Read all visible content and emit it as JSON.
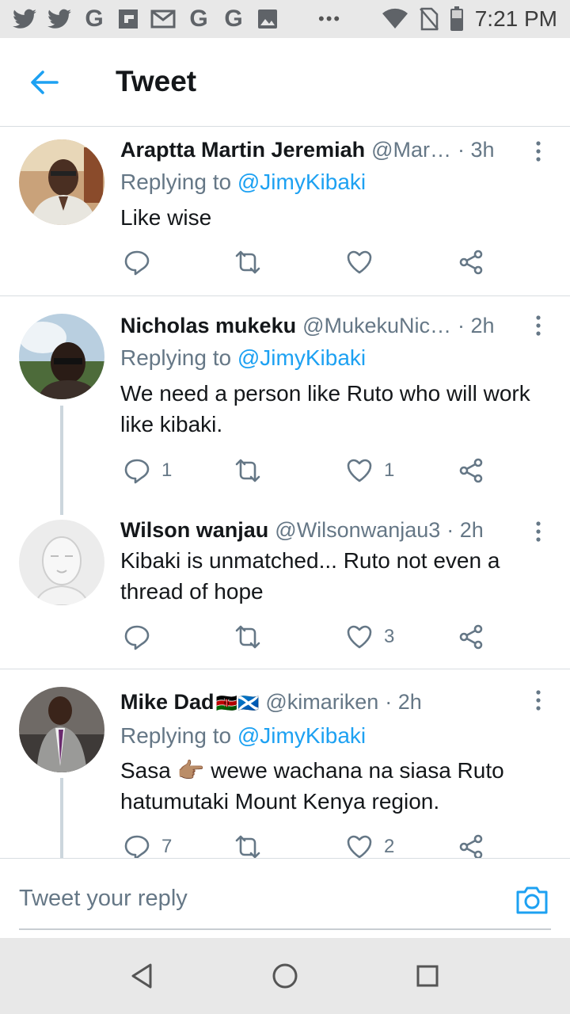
{
  "status_bar": {
    "time": "7:21 PM",
    "notification_icons": [
      "twitter-icon",
      "twitter-icon",
      "google-icon",
      "flipboard-icon",
      "gmail-icon",
      "google-icon",
      "google-icon",
      "image-icon"
    ],
    "overflow": "•••"
  },
  "header": {
    "title": "Tweet"
  },
  "tweets": [
    {
      "name": "Araptta Martin Jeremiah",
      "handle": "@Mar…",
      "time": "· 3h",
      "replying_prefix": "Replying to",
      "replying_to": "@JimyKibaki",
      "text": "Like wise",
      "reply_count": "",
      "like_count": ""
    },
    {
      "name": "Nicholas mukeku",
      "handle": "@MukekuNic…",
      "time": "· 2h",
      "replying_prefix": "Replying to",
      "replying_to": "@JimyKibaki",
      "text": "We need a person like Ruto who will work like kibaki.",
      "reply_count": "1",
      "like_count": "1"
    },
    {
      "name": "Wilson wanjau",
      "handle": "@Wilsonwanjau3",
      "time": "· 2h",
      "text": "Kibaki is unmatched... Ruto not even a thread of hope",
      "reply_count": "",
      "like_count": "3"
    },
    {
      "name": "Mike Dad",
      "name_flags": "🇰🇪🏴󠁧󠁢󠁳󠁣󠁴󠁿",
      "handle": "@kimariken",
      "time": "· 2h",
      "replying_prefix": "Replying to",
      "replying_to": "@JimyKibaki",
      "text_before": "Sasa",
      "text_emoji": "👉🏽",
      "text_after": "wewe wachana na siasa Ruto hatumutaki Mount Kenya region.",
      "reply_count": "7",
      "like_count": "2"
    }
  ],
  "composer": {
    "placeholder": "Tweet your reply"
  },
  "colors": {
    "accent": "#1da1f2",
    "secondary_text": "#657786",
    "divider": "#d8dde1"
  }
}
